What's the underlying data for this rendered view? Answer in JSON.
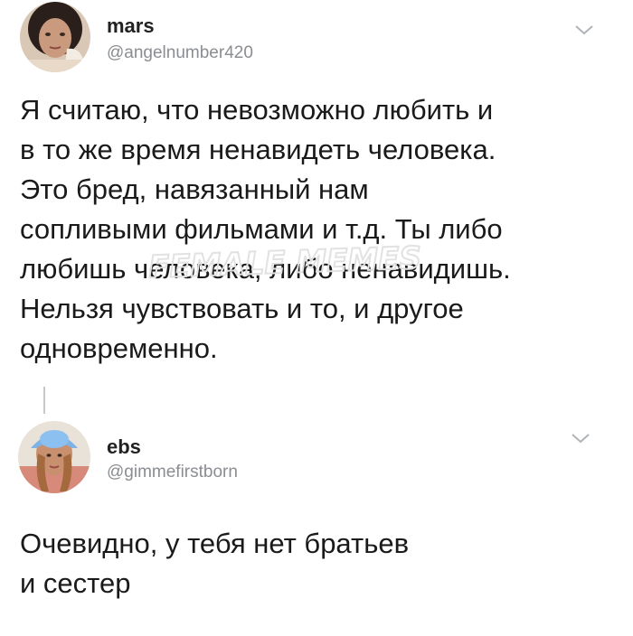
{
  "tweets": [
    {
      "display_name": "mars",
      "handle": "@angelnumber420",
      "avatar_icon": "user-avatar-photo",
      "menu_icon": "chevron-down-icon",
      "text_lines": [
        "Я считаю, что невозможно любить и",
        "в то же время ненавидеть человека.",
        "Это бред, навязанный нам",
        "сопливыми фильмами и т.д. Ты либо",
        "любишь человека, либо ненавидишь.",
        "Нельзя чувствовать и то, и другое",
        "одновременно."
      ]
    },
    {
      "display_name": "ebs",
      "handle": "@gimmefirstborn",
      "avatar_icon": "user-avatar-photo",
      "menu_icon": "chevron-down-icon",
      "text_lines": [
        "Очевидно, у тебя нет братьев",
        "и сестер"
      ]
    }
  ],
  "watermark": {
    "text": "FEMALE MEMES",
    "color": "#e7e7e7"
  },
  "colors": {
    "text": "#1a1a1a",
    "handle": "#8a8d91",
    "thread_line": "#c8c8c8"
  }
}
